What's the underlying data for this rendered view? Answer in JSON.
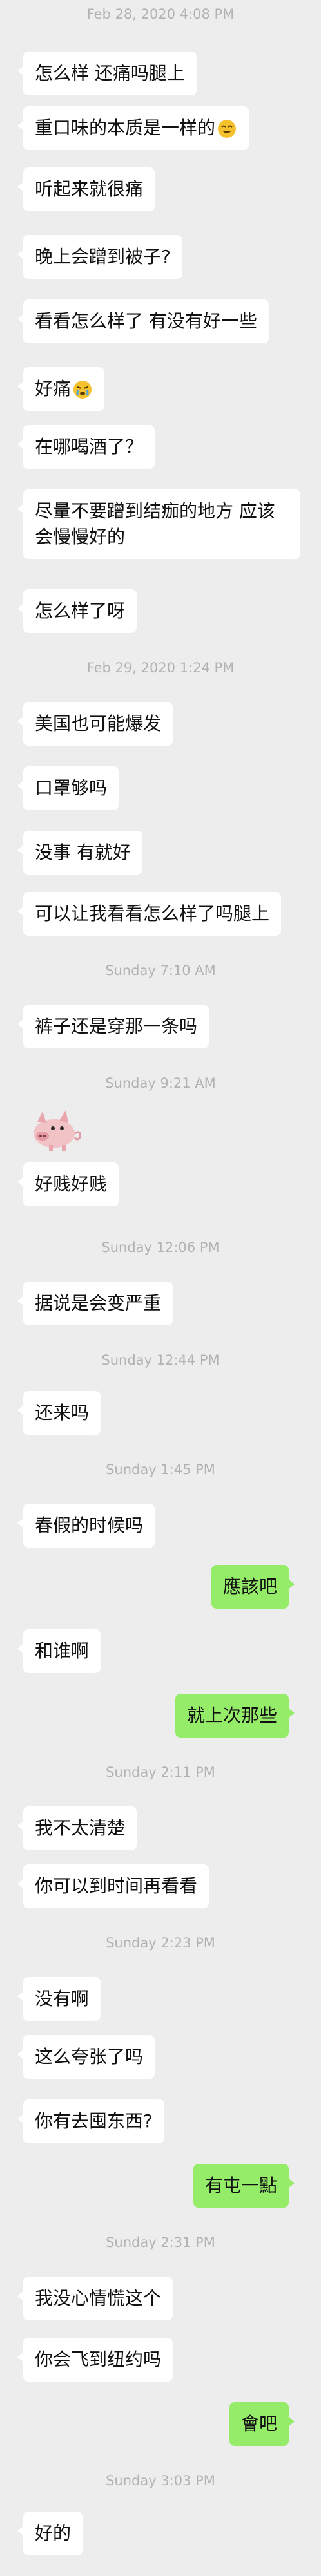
{
  "colors": {
    "background": "#ededed",
    "incoming_bubble": "#ffffff",
    "outgoing_bubble": "#95ec69",
    "timestamp": "#b2b2b2"
  },
  "timestamps": [
    "Feb 28, 2020 4:08 PM",
    "Feb 29, 2020 1:24 PM",
    "Sunday 7:10 AM",
    "Sunday 9:21 AM",
    "Sunday 12:06 PM",
    "Sunday 12:44 PM",
    "Sunday 1:45 PM",
    "Sunday 2:11 PM",
    "Sunday 2:23 PM",
    "Sunday 2:31 PM",
    "Sunday 3:03 PM"
  ],
  "messages": [
    {
      "side": "in",
      "text": "怎么样 还痛吗腿上"
    },
    {
      "side": "in",
      "text": "重口味的本质是一样的",
      "emoji": "laughing-emoji"
    },
    {
      "side": "in",
      "text": "听起来就很痛"
    },
    {
      "side": "in",
      "text": "晚上会蹭到被子?"
    },
    {
      "side": "in",
      "text": "看看怎么样了 有没有好一些"
    },
    {
      "side": "in",
      "text": "好痛",
      "emoji": "tearful-emoji"
    },
    {
      "side": "in",
      "text": "在哪喝酒了？"
    },
    {
      "side": "in",
      "text": "尽量不要蹭到结痂的地方 应该会慢慢好的"
    },
    {
      "side": "in",
      "text": "怎么样了呀"
    },
    {
      "side": "in",
      "text": "美国也可能爆发"
    },
    {
      "side": "in",
      "text": "口罩够吗"
    },
    {
      "side": "in",
      "text": "没事 有就好"
    },
    {
      "side": "in",
      "text": "可以让我看看怎么样了吗腿上"
    },
    {
      "side": "in",
      "text": "裤子还是穿那一条吗"
    },
    {
      "side": "in",
      "sticker": "pig-sticker"
    },
    {
      "side": "in",
      "text": "好贱好贱"
    },
    {
      "side": "in",
      "text": "据说是会变严重"
    },
    {
      "side": "in",
      "text": "还来吗"
    },
    {
      "side": "in",
      "text": "春假的时候吗"
    },
    {
      "side": "out",
      "text": "應該吧"
    },
    {
      "side": "in",
      "text": "和谁啊"
    },
    {
      "side": "out",
      "text": "就上次那些"
    },
    {
      "side": "in",
      "text": "我不太清楚"
    },
    {
      "side": "in",
      "text": "你可以到时间再看看"
    },
    {
      "side": "in",
      "text": "没有啊"
    },
    {
      "side": "in",
      "text": "这么夸张了吗"
    },
    {
      "side": "in",
      "text": "你有去囤东西?"
    },
    {
      "side": "out",
      "text": "有屯一點"
    },
    {
      "side": "in",
      "text": "我没心情慌这个"
    },
    {
      "side": "in",
      "text": "你会飞到纽约吗"
    },
    {
      "side": "out",
      "text": "會吧"
    },
    {
      "side": "in",
      "text": "好的"
    }
  ]
}
